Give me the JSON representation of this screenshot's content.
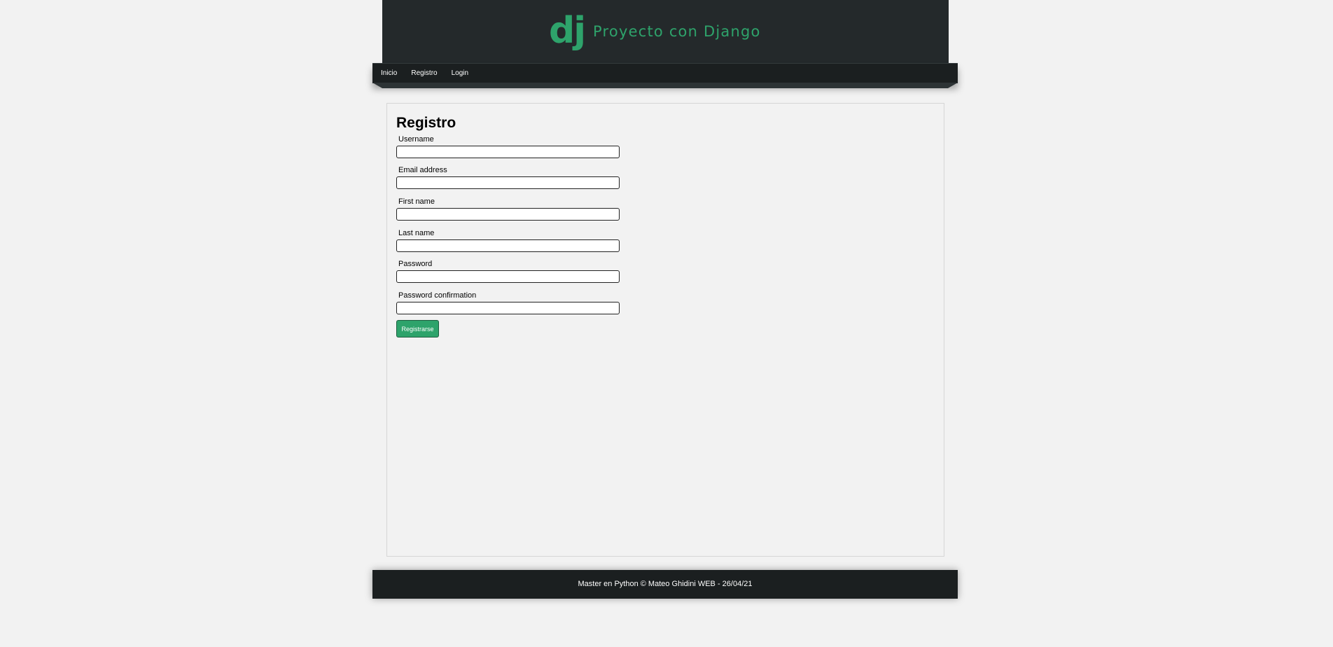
{
  "header": {
    "logo_mark": "dj",
    "site_title": "Proyecto con Django"
  },
  "nav": {
    "items": [
      {
        "label": "Inicio"
      },
      {
        "label": "Registro"
      },
      {
        "label": "Login"
      }
    ]
  },
  "main": {
    "heading": "Registro",
    "fields": [
      {
        "label": "Username",
        "value": "",
        "placeholder": ""
      },
      {
        "label": "Email address",
        "value": "",
        "placeholder": ""
      },
      {
        "label": "First name",
        "value": "",
        "placeholder": ""
      },
      {
        "label": "Last name",
        "value": "",
        "placeholder": ""
      },
      {
        "label": "Password",
        "value": "",
        "placeholder": ""
      },
      {
        "label": "Password confirmation",
        "value": "",
        "placeholder": ""
      }
    ],
    "submit_label": "Registrarse"
  },
  "footer": {
    "text": "Master en Python © Mateo Ghidini WEB - 26/04/21"
  },
  "colors": {
    "accent": "#2ea36b",
    "header_bg": "#24292b",
    "nav_bg": "#1b1f20",
    "page_bg": "#f2f2f2"
  }
}
